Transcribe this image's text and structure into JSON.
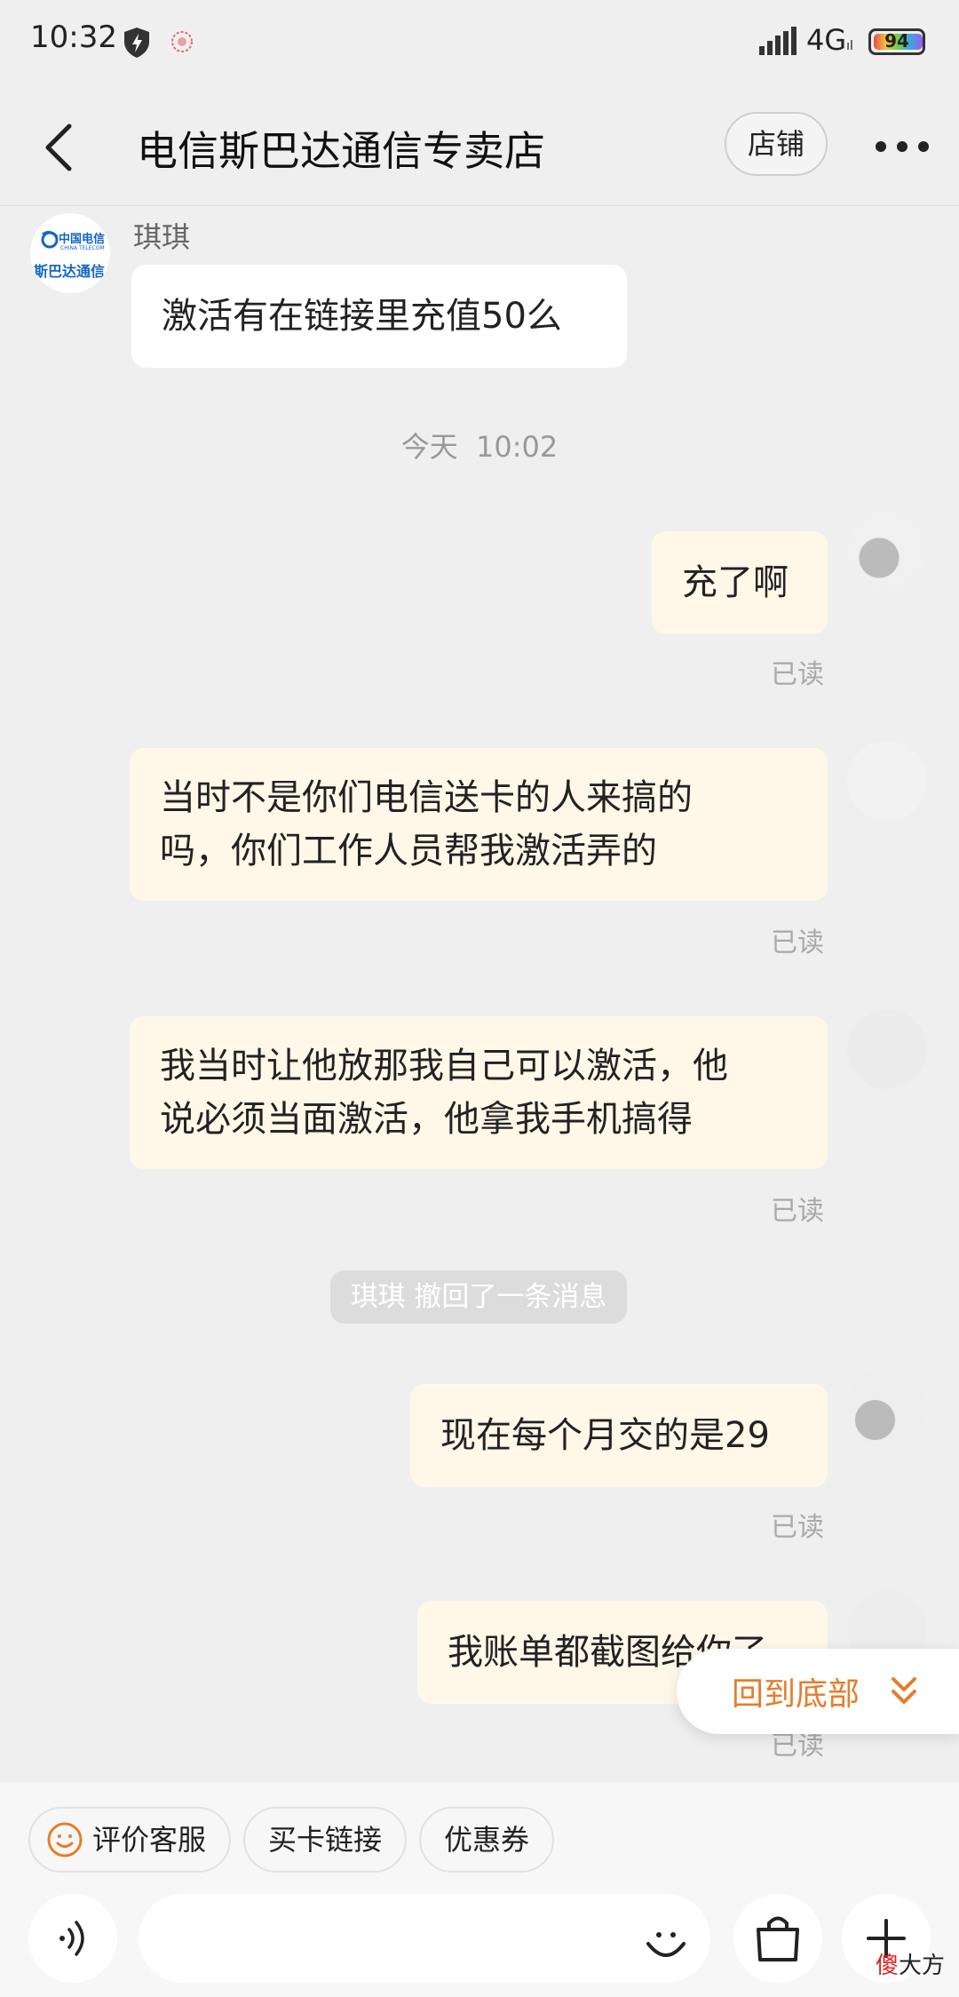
{
  "status_bar": {
    "time": "10:32",
    "network": "4G",
    "network_sub": "ıl",
    "battery": "94"
  },
  "nav": {
    "title": "电信斯巴达通信专卖店",
    "shop_button": "店铺"
  },
  "messages": {
    "sender_name": "琪琪",
    "m1": "激活有在链接里充值50么",
    "time_divider": "今天  10:02",
    "m2": "充了啊",
    "m3_line1": "当时不是你们电信送卡的人来搞的",
    "m3_line2": "吗，你们工作人员帮我激活弄的",
    "m4_line1": "我当时让他放那我自己可以激活，他",
    "m4_line2": "说必须当面激活，他拿我手机搞得",
    "recall": "琪琪 撤回了一条消息",
    "m5": "现在每个月交的是29",
    "m6": "我账单都截图给你了",
    "read_label": "已读"
  },
  "avatar_text": {
    "cn": "中国电信",
    "en": "CHINA TELECOM",
    "store": "斯巴达通信"
  },
  "back_to_bottom": "回到底部",
  "quick_chips": [
    "评价客服",
    "买卡链接",
    "优惠券"
  ],
  "watermark": {
    "red": "傻",
    "black": "大方"
  },
  "colors": {
    "accent_orange": "#e87c2a",
    "bubble_self": "#fff8e8",
    "bubble_other": "#ffffff",
    "background": "#efeff0"
  }
}
